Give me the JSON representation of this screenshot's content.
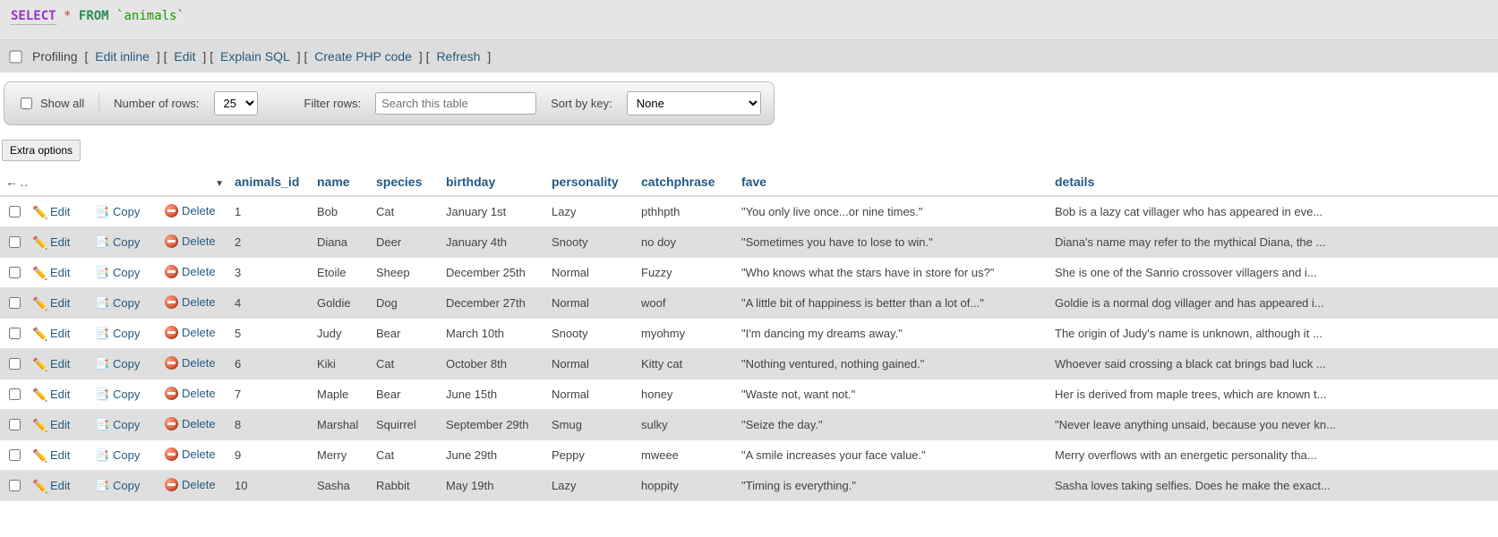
{
  "sql": {
    "select": "SELECT",
    "star": "*",
    "from": "FROM",
    "table": "`animals`"
  },
  "actionbar": {
    "profiling": "Profiling",
    "links": [
      "Edit inline",
      "Edit",
      "Explain SQL",
      "Create PHP code",
      "Refresh"
    ]
  },
  "controls": {
    "show_all": "Show all",
    "num_rows_label": "Number of rows:",
    "num_rows_value": "25",
    "filter_label": "Filter rows:",
    "filter_placeholder": "Search this table",
    "sort_label": "Sort by key:",
    "sort_value": "None"
  },
  "extra_options": "Extra options",
  "sort_icons": "←T→",
  "row_actions": {
    "edit": "Edit",
    "copy": "Copy",
    "delete": "Delete"
  },
  "columns": [
    "animals_id",
    "name",
    "species",
    "birthday",
    "personality",
    "catchphrase",
    "fave",
    "details"
  ],
  "rows": [
    {
      "id": 1,
      "name": "Bob",
      "species": "Cat",
      "birthday": "January 1st",
      "personality": "Lazy",
      "catchphrase": "pthhpth",
      "fave": "\"You only live once...or nine times.\"",
      "details": "Bob is a lazy cat villager who has appeared in eve..."
    },
    {
      "id": 2,
      "name": "Diana",
      "species": "Deer",
      "birthday": "January 4th",
      "personality": "Snooty",
      "catchphrase": "no doy",
      "fave": "\"Sometimes you have to lose to win.\"",
      "details": "Diana's name may refer to the mythical Diana, the ..."
    },
    {
      "id": 3,
      "name": "Etoile",
      "species": "Sheep",
      "birthday": "December 25th",
      "personality": "Normal",
      "catchphrase": "Fuzzy",
      "fave": "\"Who knows what the stars have in store for us?\"",
      "details": "She is one of the Sanrio crossover villagers and i..."
    },
    {
      "id": 4,
      "name": "Goldie",
      "species": "Dog",
      "birthday": "December 27th",
      "personality": "Normal",
      "catchphrase": "woof",
      "fave": "\"A little bit of happiness is better than a lot of...\"",
      "details": "Goldie is a normal dog villager and has appeared i..."
    },
    {
      "id": 5,
      "name": "Judy",
      "species": "Bear",
      "birthday": "March 10th",
      "personality": "Snooty",
      "catchphrase": "myohmy",
      "fave": "\"I'm dancing my dreams away.\"",
      "details": "The origin of Judy's name is unknown, although it ..."
    },
    {
      "id": 6,
      "name": "Kiki",
      "species": "Cat",
      "birthday": "October 8th",
      "personality": "Normal",
      "catchphrase": "Kitty cat",
      "fave": "\"Nothing ventured, nothing gained.\"",
      "details": "Whoever said crossing a black cat brings bad luck ..."
    },
    {
      "id": 7,
      "name": "Maple",
      "species": "Bear",
      "birthday": "June 15th",
      "personality": "Normal",
      "catchphrase": "honey",
      "fave": "\"Waste not, want not.\"",
      "details": "Her is derived from maple trees, which are known t..."
    },
    {
      "id": 8,
      "name": "Marshal",
      "species": "Squirrel",
      "birthday": "September 29th",
      "personality": "Smug",
      "catchphrase": "sulky",
      "fave": "\"Seize the day.\"",
      "details": "\"Never leave anything unsaid, because you never kn..."
    },
    {
      "id": 9,
      "name": "Merry",
      "species": "Cat",
      "birthday": "June 29th",
      "personality": "Peppy",
      "catchphrase": "mweee",
      "fave": "\"A smile increases your face value.\"",
      "details": " Merry overflows with an energetic personality tha..."
    },
    {
      "id": 10,
      "name": "Sasha",
      "species": "Rabbit",
      "birthday": "May 19th",
      "personality": "Lazy",
      "catchphrase": "hoppity",
      "fave": "\"Timing is everything.\"",
      "details": "Sasha loves taking selfies. Does he make the exact..."
    }
  ]
}
